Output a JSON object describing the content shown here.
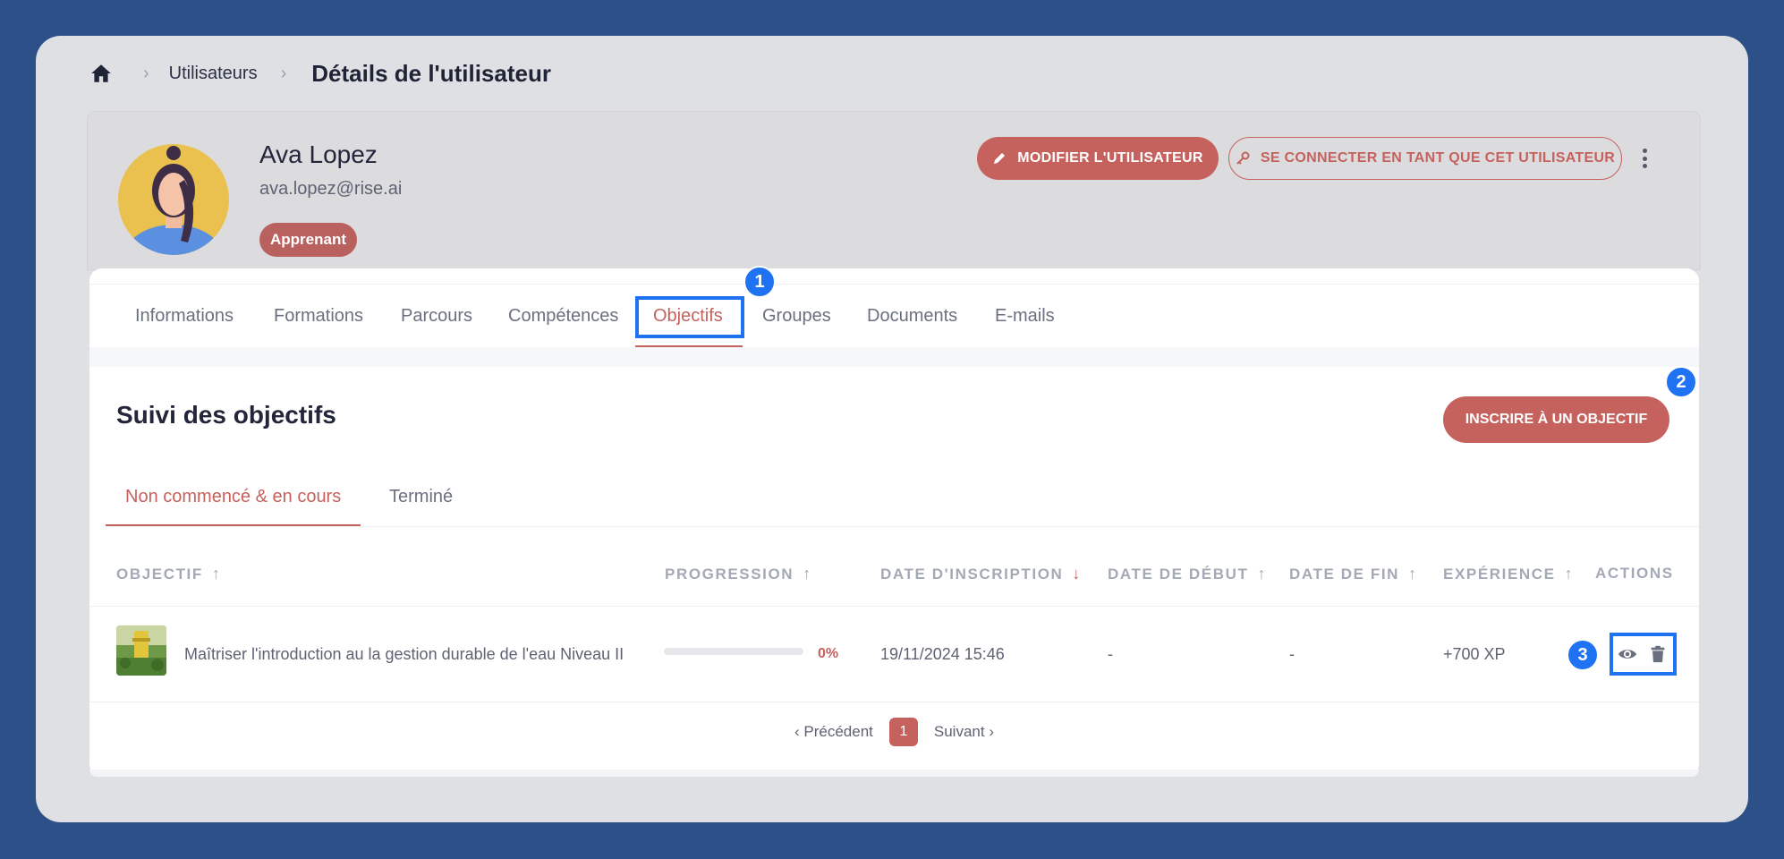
{
  "breadcrumb": {
    "home_icon": "home-icon",
    "item1": "Utilisateurs",
    "current": "Détails de l'utilisateur"
  },
  "user": {
    "name": "Ava Lopez",
    "email": "ava.lopez@rise.ai",
    "role": "Apprenant"
  },
  "actions": {
    "edit_label": "MODIFIER L'UTILISATEUR",
    "login_as_label": "SE CONNECTER EN TANT QUE CET UTILISATEUR",
    "more_icon": "more-vertical-icon"
  },
  "tabs": [
    {
      "label": "Informations"
    },
    {
      "label": "Formations"
    },
    {
      "label": "Parcours"
    },
    {
      "label": "Compétences"
    },
    {
      "label": "Objectifs"
    },
    {
      "label": "Groupes"
    },
    {
      "label": "Documents"
    },
    {
      "label": "E-mails"
    }
  ],
  "active_tab": "Objectifs",
  "markers": [
    "1",
    "2",
    "3"
  ],
  "section": {
    "title": "Suivi des objectifs",
    "enroll_label": "INSCRIRE À UN OBJECTIF",
    "subtabs": [
      "Non commencé & en cours",
      "Terminé"
    ]
  },
  "table": {
    "headers": [
      "OBJECTIF",
      "PROGRESSION",
      "DATE D'INSCRIPTION",
      "DATE DE DÉBUT",
      "DATE DE FIN",
      "EXPÉRIENCE",
      "ACTIONS"
    ],
    "sort_up": "↑",
    "sort_down": "↓",
    "rows": [
      {
        "objective": "Maîtriser l'introduction au la gestion durable de l'eau Niveau II",
        "progress": "0%",
        "progress_value": 0,
        "enrolled": "19/11/2024 15:46",
        "start": "-",
        "end": "-",
        "xp": "+700 XP"
      }
    ]
  },
  "pagination": {
    "prev": "Précédent",
    "page": "1",
    "next": "Suivant"
  },
  "colors": {
    "accent": "#c5625e",
    "highlight": "#1f73f2",
    "background": "#2d5089"
  }
}
